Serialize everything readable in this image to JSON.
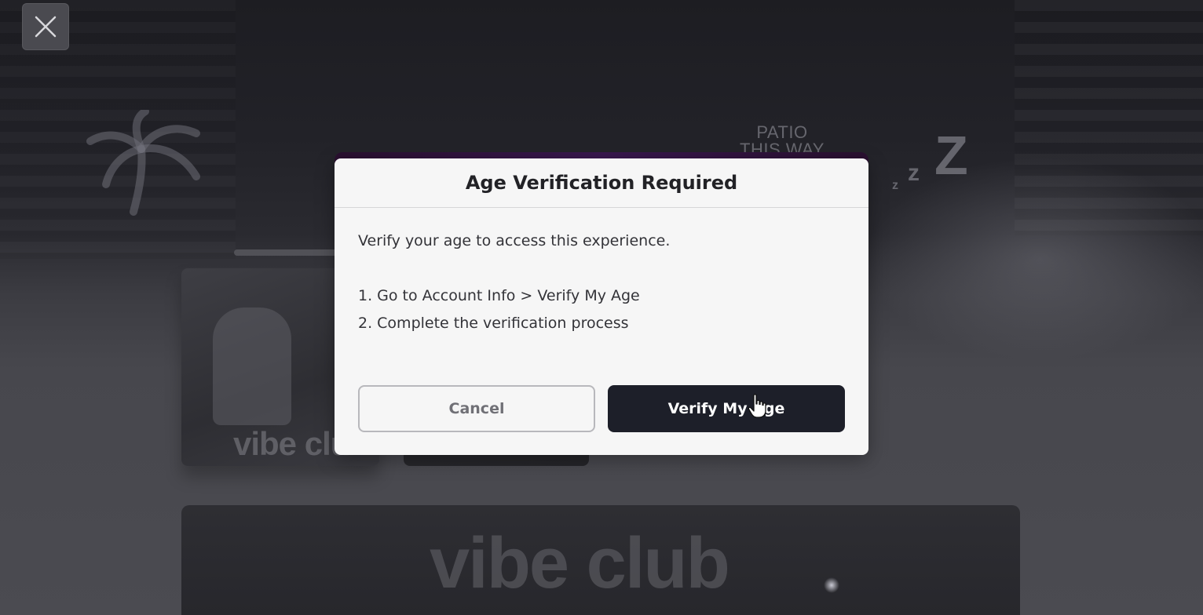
{
  "background": {
    "sign_text_line1": "PATIO",
    "sign_text_line2": "THIS WAY",
    "zzz": [
      "z",
      "z",
      "Z"
    ],
    "thumbnail_logo": "vibe club",
    "banner_logo": "vibe club"
  },
  "close_button": {
    "icon": "close-icon"
  },
  "dialog": {
    "title": "Age Verification Required",
    "intro": "Verify your age to access this experience.",
    "steps": [
      "1. Go to Account Info > Verify My Age",
      "2. Complete the verification process"
    ],
    "cancel_label": "Cancel",
    "verify_label": "Verify My Age"
  },
  "colors": {
    "dialog_background": "#f6f6f6",
    "primary_button": "#1d1f29",
    "cancel_border": "#b8b8bc",
    "title_text": "#222226"
  }
}
